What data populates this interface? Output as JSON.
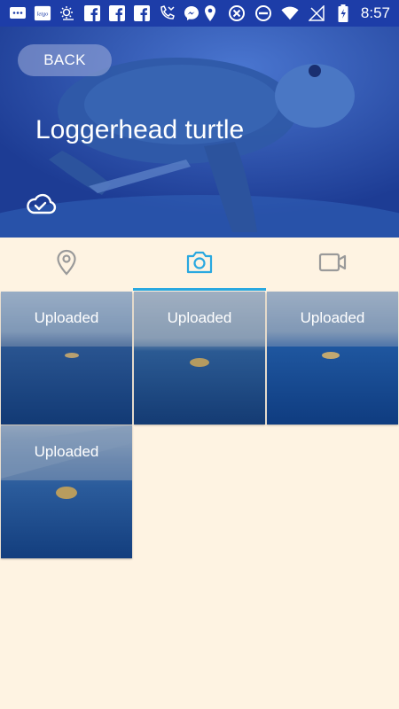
{
  "status_bar": {
    "time": "8:57",
    "left_icons": [
      "messages-icon",
      "app-icon",
      "weather-icon",
      "facebook-icon",
      "facebook-icon",
      "facebook-icon",
      "missed-call-icon",
      "messenger-icon"
    ],
    "right_icons": [
      "location-icon",
      "close-circle-icon",
      "dnd-icon",
      "wifi-icon",
      "no-signal-icon",
      "battery-charging-icon"
    ],
    "app_icon_text": "letgo"
  },
  "hero": {
    "back_label": "BACK",
    "title": "Loggerhead turtle",
    "bg_color": "#2449a8"
  },
  "tabs": [
    {
      "name": "location",
      "icon": "map-pin-icon",
      "active": false
    },
    {
      "name": "photos",
      "icon": "camera-icon",
      "active": true
    },
    {
      "name": "videos",
      "icon": "video-icon",
      "active": false
    }
  ],
  "photos": [
    {
      "label": "Uploaded"
    },
    {
      "label": "Uploaded"
    },
    {
      "label": "Uploaded"
    },
    {
      "label": "Uploaded"
    }
  ],
  "colors": {
    "accent": "#29a8e0",
    "background": "#fef3e2",
    "status_bar": "#1d3da8"
  }
}
